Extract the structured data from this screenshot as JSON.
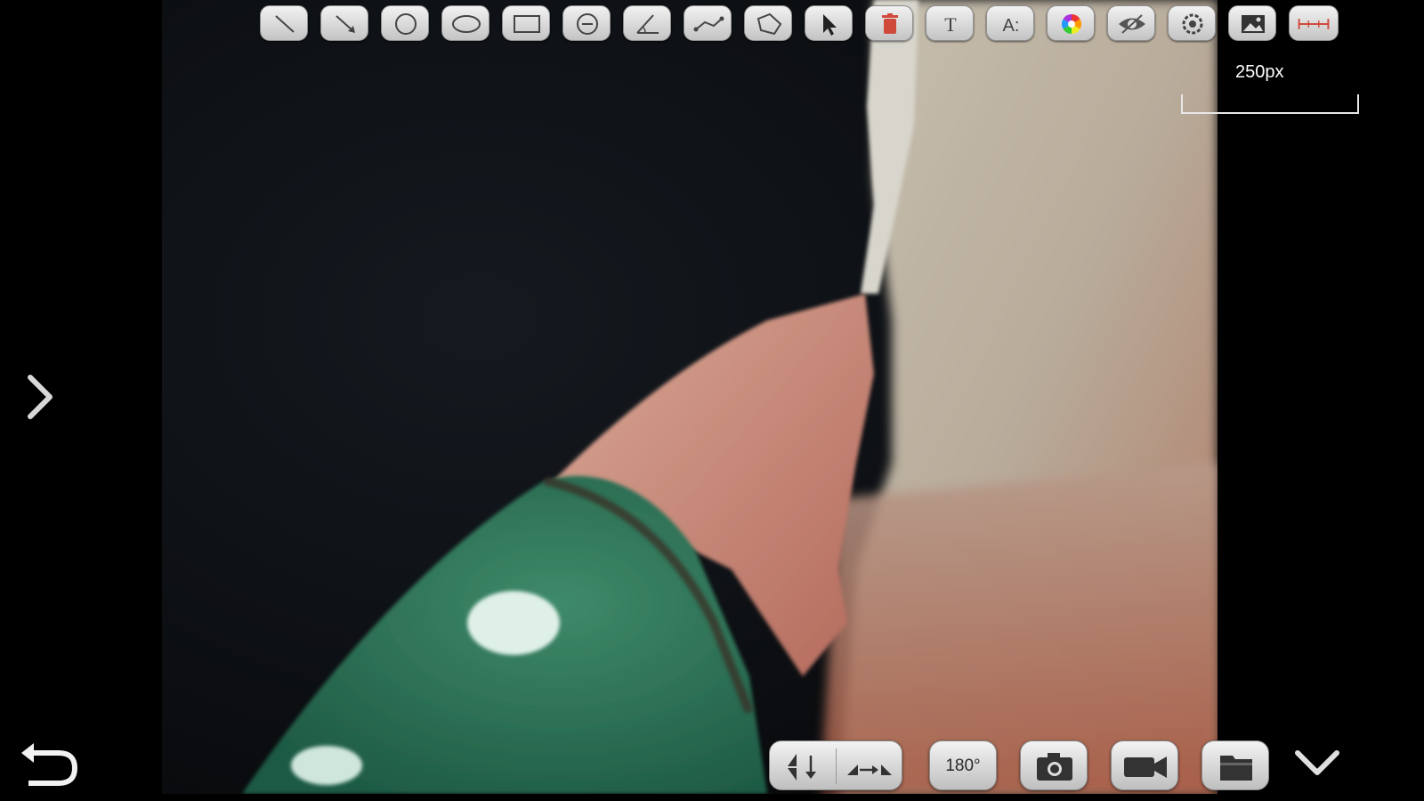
{
  "app": {
    "toolbar": [
      {
        "id": "line",
        "icon": "line-tool-icon"
      },
      {
        "id": "arrow",
        "icon": "arrow-line-tool-icon"
      },
      {
        "id": "circle",
        "icon": "circle-tool-icon"
      },
      {
        "id": "ellipse",
        "icon": "ellipse-tool-icon"
      },
      {
        "id": "rectangle",
        "icon": "rectangle-tool-icon"
      },
      {
        "id": "three-point-circle",
        "icon": "three-point-circle-icon"
      },
      {
        "id": "angle",
        "icon": "angle-tool-icon"
      },
      {
        "id": "polyline",
        "icon": "polyline-tool-icon"
      },
      {
        "id": "polygon",
        "icon": "polygon-tool-icon"
      },
      {
        "id": "select",
        "icon": "cursor-icon"
      },
      {
        "id": "delete",
        "icon": "trash-icon"
      },
      {
        "id": "text",
        "icon": "text-tool-icon",
        "label": "T"
      },
      {
        "id": "font",
        "icon": "font-size-icon",
        "label": "A:"
      },
      {
        "id": "color",
        "icon": "color-wheel-icon"
      },
      {
        "id": "visibility",
        "icon": "eye-icon"
      },
      {
        "id": "settings",
        "icon": "gear-icon"
      },
      {
        "id": "image",
        "icon": "image-icon"
      },
      {
        "id": "scale",
        "icon": "scale-ruler-icon"
      }
    ],
    "scale": {
      "label": "250px"
    },
    "bottom_bar": {
      "flip_vertical_icon": "flip-vertical-icon",
      "flip_horizontal_icon": "flip-horizontal-icon",
      "rotate_label": "180°",
      "capture_icon": "camera-icon",
      "record_icon": "video-camera-icon",
      "gallery_icon": "folder-icon"
    },
    "nav": {
      "expand_icon": "chevron-right-icon",
      "back_icon": "back-arrow-icon",
      "collapse_icon": "chevron-down-icon"
    },
    "colors": {
      "accent_red": "#d04a3c",
      "background": "#000000"
    }
  }
}
